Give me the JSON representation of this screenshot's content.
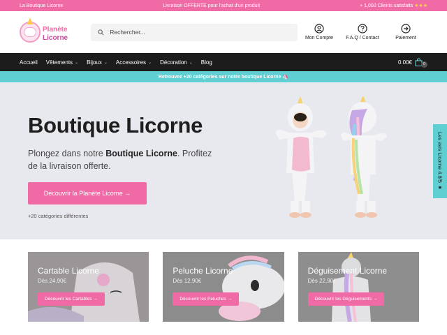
{
  "topbar": {
    "left": "La Boutique Licorne",
    "center": "Livraison OFFERTE pour l'achat d'un produit",
    "right": "+ 1,000 Clients satisfaits",
    "stars": "★★★"
  },
  "logo": {
    "line1": "Planète",
    "line2": "Licorne"
  },
  "search": {
    "placeholder": "Rechercher..."
  },
  "header_icons": [
    {
      "icon": "user-icon",
      "label": "Mon Compte"
    },
    {
      "icon": "help-icon",
      "label": "F.A.Q / Contact"
    },
    {
      "icon": "arrow-right-circle-icon",
      "label": "Paiement"
    }
  ],
  "nav": {
    "items": [
      "Accueil",
      "Vêtements",
      "Bijoux",
      "Accessoires",
      "Décoration",
      "Blog"
    ],
    "cart_total": "0.00€",
    "cart_count": "0"
  },
  "strip": {
    "text": "Retrouvez +20 catégories sur notre boutique Licorne 🦄"
  },
  "hero": {
    "title": "Boutique Licorne",
    "text_before": "Plongez dans notre ",
    "text_bold": "Boutique Licorne",
    "text_after": ". Profitez de la livraison offerte.",
    "cta": "Découvrir la Planète Licorne →",
    "sub": "+20 catégories différentes"
  },
  "sidetab": {
    "text": "Les avis Licorne 4.8/5 ★"
  },
  "cards": [
    {
      "title": "Cartable Licorne",
      "price": "Dès 24,90€",
      "button": "Découvrir les Cartables →"
    },
    {
      "title": "Peluche Licorne",
      "price": "Dès 12,90€",
      "button": "Découvrir les Peluches →"
    },
    {
      "title": "Déguisement Licorne",
      "price": "Dès 22,90€",
      "button": "Découvrir les Déguisements →"
    }
  ],
  "colors": {
    "pink": "#f06ba6",
    "teal": "#5fcfd2",
    "dark": "#1c1c1c",
    "hero_bg": "#e8e9ef"
  }
}
